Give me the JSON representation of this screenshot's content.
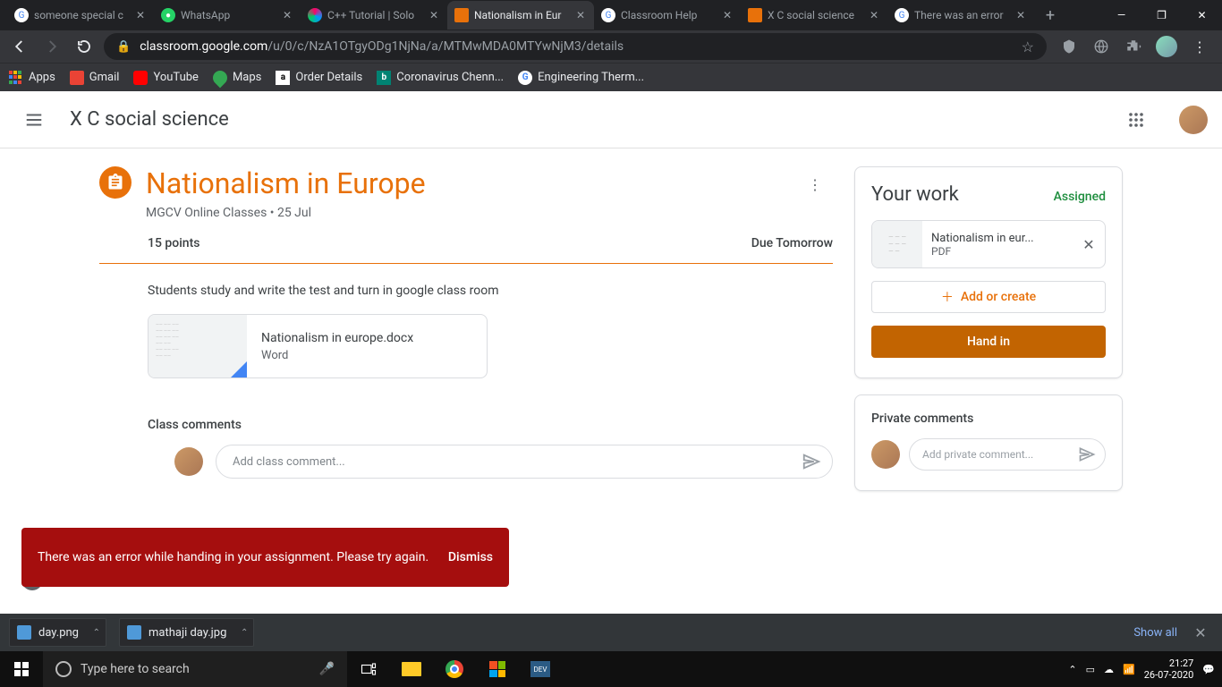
{
  "browser": {
    "tabs": [
      {
        "title": "someone special c",
        "favicon": "G"
      },
      {
        "title": "WhatsApp",
        "favicon": "W"
      },
      {
        "title": "C++ Tutorial | Solo",
        "favicon": "S"
      },
      {
        "title": "Nationalism in Eur",
        "favicon": "C",
        "active": true
      },
      {
        "title": "Classroom Help",
        "favicon": "G"
      },
      {
        "title": "X C social science",
        "favicon": "C"
      },
      {
        "title": "There was an error",
        "favicon": "G"
      }
    ],
    "url_prefix": "classroom.google.com",
    "url_path": "/u/0/c/NzA1OTgyODg1NjNa/a/MTMwMDA0MTYwNjM3/details",
    "bookmarks": [
      "Apps",
      "Gmail",
      "YouTube",
      "Maps",
      "Order Details",
      "Coronavirus Chenn...",
      "Engineering Therm..."
    ]
  },
  "header": {
    "class_name": "X C social science"
  },
  "assignment": {
    "title": "Nationalism in Europe",
    "author": "MGCV Online Classes",
    "date": "25 Jul",
    "points": "15 points",
    "due": "Due Tomorrow",
    "description": "Students study and write the test and turn in google class room",
    "material_name": "Nationalism in europe.docx",
    "material_type": "Word"
  },
  "comments": {
    "heading": "Class comments",
    "placeholder": "Add class comment..."
  },
  "work": {
    "heading": "Your work",
    "status": "Assigned",
    "attachment_name": "Nationalism in eur...",
    "attachment_type": "PDF",
    "add_label": "Add or create",
    "handin_label": "Hand in"
  },
  "private": {
    "heading": "Private comments",
    "placeholder": "Add private comment..."
  },
  "toast": {
    "message": "There was an error while handing in your assignment. Please try again.",
    "dismiss": "Dismiss"
  },
  "downloads": {
    "items": [
      "day.png",
      "mathaji day.jpg"
    ],
    "show_all": "Show all"
  },
  "taskbar": {
    "search_placeholder": "Type here to search",
    "time": "21:27",
    "date": "26-07-2020"
  }
}
